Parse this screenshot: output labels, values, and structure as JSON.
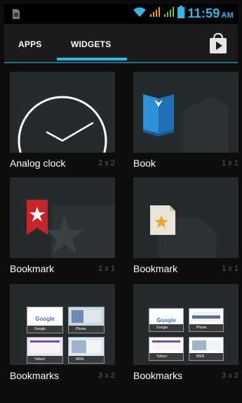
{
  "status_bar": {
    "time": "11:59",
    "ampm": "AM",
    "icons": [
      "sim-icon",
      "wifi-icon",
      "signal-orange-icon",
      "signal-green-icon",
      "battery-icon"
    ],
    "accent": "#33b5e5"
  },
  "tabs": {
    "apps_label": "APPS",
    "widgets_label": "WIDGETS",
    "selected": "WIDGETS"
  },
  "widgets": [
    {
      "name": "Analog clock",
      "size": "2 x 2",
      "icon": "clock-face"
    },
    {
      "name": "Book",
      "size": "1 x 1",
      "icon": "book-icon"
    },
    {
      "name": "Bookmark",
      "size": "1 x 1",
      "icon": "bookmark-star-icon"
    },
    {
      "name": "Bookmark",
      "size": "1 x 1",
      "icon": "bookmark-page-icon"
    },
    {
      "name": "Bookmarks",
      "size": "3 x 2",
      "icon": "bookmarks-thumbnails"
    },
    {
      "name": "Bookmarks",
      "size": "3 x 2",
      "icon": "bookmarks-thumbnails"
    }
  ],
  "bookmark_thumbs": {
    "google": "Google",
    "phone": "Phone",
    "yahoo": "Yahoo!",
    "msn": "MSN"
  }
}
